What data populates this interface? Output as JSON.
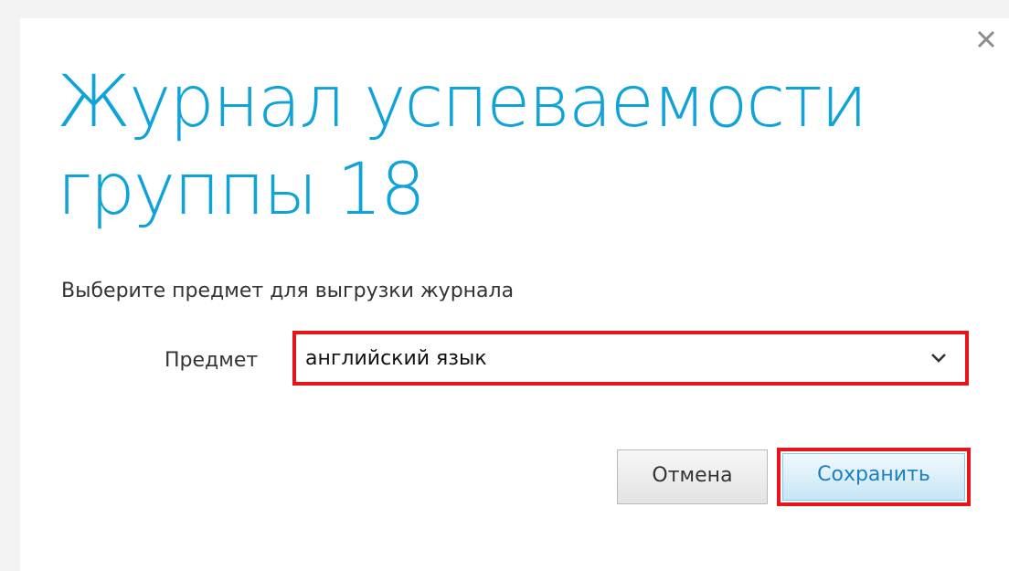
{
  "dialog": {
    "title": "Журнал успеваемости группы 18",
    "subtitle": "Выберите предмет для выгрузки журнала",
    "close_icon": "close-icon"
  },
  "form": {
    "subject_label": "Предмет",
    "subject_value": "английский язык",
    "dropdown_icon": "chevron-down-icon"
  },
  "buttons": {
    "cancel_label": "Отмена",
    "save_label": "Сохранить"
  },
  "colors": {
    "title": "#0fa3da",
    "highlight": "#e8141b",
    "save_text": "#1c7fc0"
  }
}
